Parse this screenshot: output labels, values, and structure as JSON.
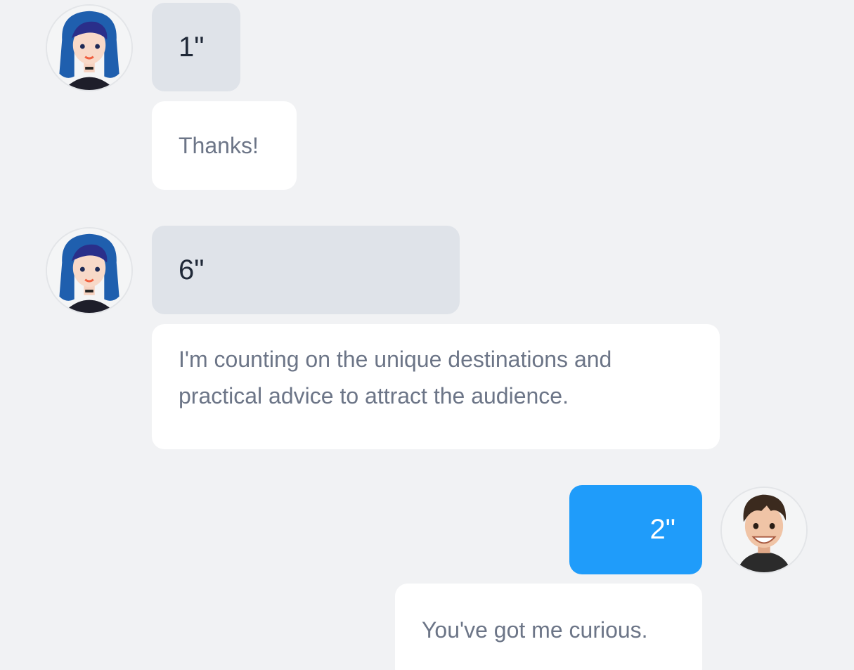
{
  "messages": [
    {
      "sender": "female-contact",
      "direction": "incoming",
      "duration_label": "1\"",
      "text": "Thanks!"
    },
    {
      "sender": "female-contact",
      "direction": "incoming",
      "duration_label": "6\"",
      "text": "I'm counting on the unique destinations and practical advice to attract the audience."
    },
    {
      "sender": "male-user",
      "direction": "outgoing",
      "duration_label": "2\"",
      "text": "You've got me curious."
    }
  ],
  "colors": {
    "background": "#f1f2f4",
    "incoming_voice_bubble": "#dfe3e9",
    "outgoing_voice_bubble": "#1f9cfa",
    "text_bubble": "#ffffff",
    "text_color": "#6c7587"
  },
  "icons": [
    "female-avatar",
    "male-avatar"
  ]
}
